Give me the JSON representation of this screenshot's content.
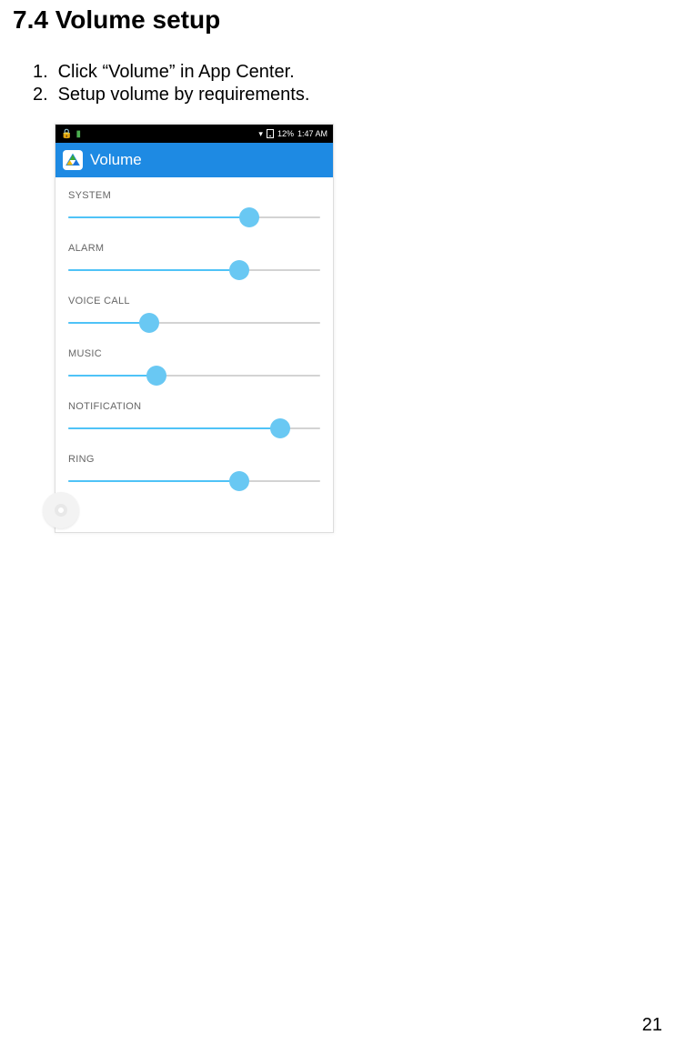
{
  "heading": "7.4 Volume setup",
  "instructions": [
    "Click “Volume” in App Center.",
    "Setup volume by requirements."
  ],
  "page_number": "21",
  "screenshot": {
    "status_bar": {
      "battery_pct": "12%",
      "time": "1:47 AM"
    },
    "app_bar": {
      "title": "Volume",
      "icon_name": "triangle-logo"
    },
    "sliders": [
      {
        "label": "SYSTEM",
        "pct": 72
      },
      {
        "label": "ALARM",
        "pct": 68
      },
      {
        "label": "VOICE CALL",
        "pct": 32
      },
      {
        "label": "MUSIC",
        "pct": 35
      },
      {
        "label": "NOTIFICATION",
        "pct": 84
      },
      {
        "label": "RING",
        "pct": 68
      }
    ]
  }
}
